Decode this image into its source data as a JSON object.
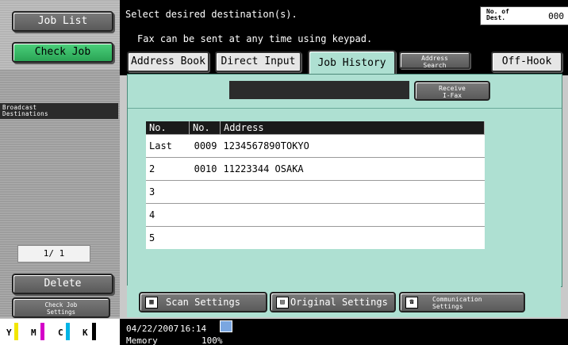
{
  "sidebar": {
    "job_list": "Job List",
    "check_job": "Check Job",
    "broadcast_line1": "Broadcast",
    "broadcast_line2": "Destinations",
    "page_counter": "1/ 1",
    "delete": "Delete",
    "check_job_settings_line1": "Check Job",
    "check_job_settings_line2": "Settings",
    "toner": [
      {
        "label": "Y",
        "color": "#f2e600"
      },
      {
        "label": "M",
        "color": "#d400c8"
      },
      {
        "label": "C",
        "color": "#00b4e6"
      },
      {
        "label": "K",
        "color": "#000000"
      }
    ]
  },
  "header": {
    "message_line1": "Select desired destination(s).",
    "message_line2": "Fax can be sent at any time using keypad.",
    "dest_label_line1": "No. of",
    "dest_label_line2": "Dest.",
    "dest_count": "000"
  },
  "tabs": [
    {
      "label": "Address Book"
    },
    {
      "label": "Direct Input"
    },
    {
      "label": "Job History",
      "active": true
    },
    {
      "label_line1": "Address",
      "label_line2": "Search"
    },
    {
      "label": "Off-Hook"
    }
  ],
  "panel": {
    "receive_line1": "Receive",
    "receive_line2": "I-Fax",
    "columns": [
      "No.",
      "No.",
      "Address"
    ],
    "rows": [
      {
        "no": "Last",
        "num": "0009",
        "address": "1234567890TOKYO"
      },
      {
        "no": "2",
        "num": "0010",
        "address": "11223344 OSAKA"
      },
      {
        "no": "3",
        "num": "",
        "address": ""
      },
      {
        "no": "4",
        "num": "",
        "address": ""
      },
      {
        "no": "5",
        "num": "",
        "address": ""
      }
    ]
  },
  "bottom": {
    "scan_settings": "Scan Settings",
    "original_settings": "Original Settings",
    "comm_line1": "Communication",
    "comm_line2": "Settings"
  },
  "status": {
    "date": "04/22/2007",
    "time": "16:14",
    "memory_label": "Memory",
    "memory_value": "100%"
  },
  "colors": {
    "panel_bg": "#aee0d2",
    "check_job_green": "#2aa455"
  }
}
